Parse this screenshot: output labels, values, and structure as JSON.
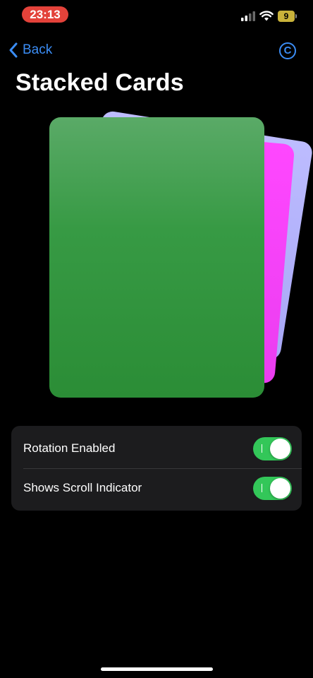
{
  "status_bar": {
    "time": "23:13",
    "battery": "9",
    "signal_icon": "cellular-signal-icon",
    "wifi_icon": "wifi-icon"
  },
  "nav": {
    "back_label": "Back",
    "back_icon": "chevron-left-icon",
    "copyright_symbol": "C"
  },
  "title": "Stacked Cards",
  "cards": [
    {
      "name": "green",
      "color": "#2f943b"
    },
    {
      "name": "magenta",
      "color": "#f042f7"
    },
    {
      "name": "lavender",
      "color": "#b1b1fa"
    }
  ],
  "settings": {
    "rotation": {
      "label": "Rotation Enabled",
      "enabled": true
    },
    "scroll_indicator": {
      "label": "Shows Scroll Indicator",
      "enabled": true
    }
  },
  "colors": {
    "accent": "#3b8df5",
    "toggle_on": "#33c759",
    "time_pill": "#e3423a",
    "group_background": "#1c1c1e"
  }
}
